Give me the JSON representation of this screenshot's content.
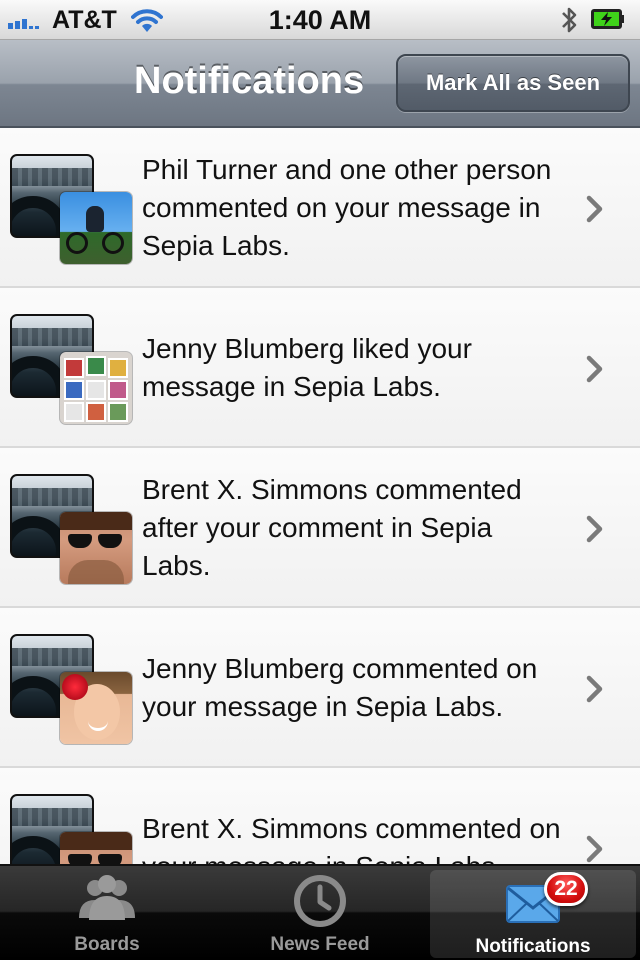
{
  "status_bar": {
    "carrier": "AT&T",
    "time": "1:40 AM",
    "icons": [
      "signal-icon",
      "wifi-icon",
      "bluetooth-icon",
      "battery-charging-icon"
    ]
  },
  "nav_bar": {
    "title": "Notifications",
    "mark_all_label": "Mark All as Seen"
  },
  "notifications": [
    {
      "text": "Phil Turner and one other person commented on your message in Sepia Labs.",
      "board_icon": "board-thumbnail",
      "avatar": "cyclist-avatar"
    },
    {
      "text": "Jenny Blumberg liked your message in Sepia Labs.",
      "board_icon": "board-thumbnail",
      "avatar": "cards-avatar"
    },
    {
      "text": "Brent X. Simmons commented after your comment in Sepia Labs.",
      "board_icon": "board-thumbnail",
      "avatar": "sunglasses-avatar"
    },
    {
      "text": "Jenny Blumberg commented on your message in Sepia Labs.",
      "board_icon": "board-thumbnail",
      "avatar": "flower-avatar"
    },
    {
      "text": "Brent X. Simmons commented on your message in Sepia Labs.",
      "board_icon": "board-thumbnail",
      "avatar": "sunglasses-avatar"
    }
  ],
  "tab_bar": {
    "tabs": [
      {
        "label": "Boards",
        "icon": "people-icon",
        "selected": false
      },
      {
        "label": "News Feed",
        "icon": "clock-icon",
        "selected": false
      },
      {
        "label": "Notifications",
        "icon": "envelope-icon",
        "selected": true,
        "badge": "22"
      }
    ]
  },
  "colors": {
    "nav_bar": "#7d8692",
    "tab_bar": "#1a1a1a",
    "badge": "#d40f0f",
    "signal_bars": "#2f74d0",
    "battery": "#3fd21a"
  }
}
